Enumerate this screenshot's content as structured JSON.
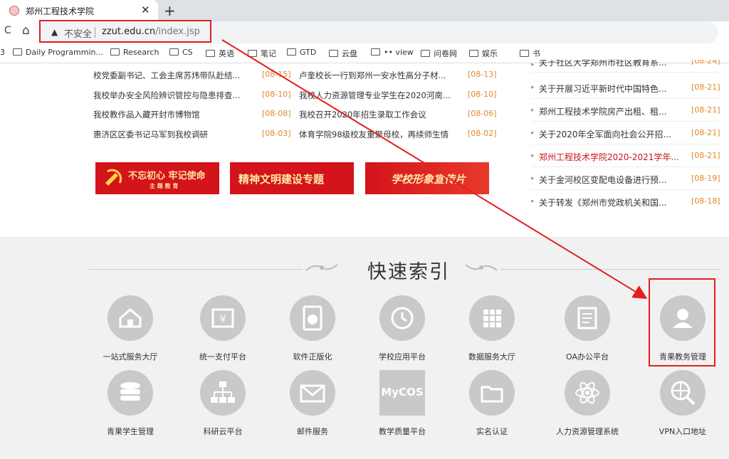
{
  "browser": {
    "tab_title": "郑州工程技术学院",
    "tab_close": "✕",
    "new_tab": "+",
    "back": "C",
    "home": "⌂",
    "warning_glyph": "▲",
    "security_label": "不安全",
    "url_host": "zzut.edu.cn",
    "url_path": "/index.jsp"
  },
  "bookmarks": [
    "Daily Programmin...",
    "Research",
    "CS",
    "英语",
    "笔记",
    "GTD",
    "云盘",
    "•• view",
    "问卷网",
    "娱乐",
    "书"
  ],
  "news_left": [
    {
      "title": "校党委副书记、工会主席苏炜带队赴结...",
      "date": "[08-15]"
    },
    {
      "title": "我校举办安全风险辨识管控与隐患排查...",
      "date": "[08-10]"
    },
    {
      "title": "我校教作品入藏开封市博物馆",
      "date": "[08-08]"
    },
    {
      "title": "惠济区区委书记马军到我校调研",
      "date": "[08-03]"
    }
  ],
  "news_mid": [
    {
      "title": "卢奎校长一行到郑州一安水性高分子材...",
      "date": "[08-13]"
    },
    {
      "title": "我校人力资源管理专业学生在2020河南...",
      "date": "[08-10]"
    },
    {
      "title": "我校召开2020年招生录取工作会议",
      "date": "[08-06]"
    },
    {
      "title": "体育学院98级校友重聚母校，再续师生情",
      "date": "[08-02]"
    }
  ],
  "banners": {
    "b1_main": "不忘初心 牢记使命",
    "b1_sub": "主 题 教 育",
    "b2": "精神文明建设专题",
    "b3": "学校形象宣传片"
  },
  "notices": [
    {
      "title": "关于社区大学郑州市社区教育系...",
      "date": "[08-24]"
    },
    {
      "title": "关于开展习近平新时代中国特色...",
      "date": "[08-21]"
    },
    {
      "title": "郑州工程技术学院房产出租、租...",
      "date": "[08-21]"
    },
    {
      "title": "关于2020年全军面向社会公开招...",
      "date": "[08-21]"
    },
    {
      "title": "郑州工程技术学院2020-2021学年...",
      "date": "[08-21]"
    },
    {
      "title": "关于金河校区变配电设备进行预...",
      "date": "[08-19]"
    },
    {
      "title": "关于转发《郑州市党政机关和国...",
      "date": "[08-18]"
    }
  ],
  "quick_index": {
    "title": "快速索引",
    "row1": [
      "一站式服务大厅",
      "统一支付平台",
      "软件正版化",
      "学校应用平台",
      "数据服务大厅",
      "OA办公平台",
      "青果教务管理"
    ],
    "row2": [
      "青果学生管理",
      "科研云平台",
      "邮件服务",
      "教学质量平台",
      "实名认证",
      "人力资源管理系统",
      "VPN入口地址"
    ],
    "mycos_text": "MyCOS",
    "yen_glyph": "¥"
  },
  "colors": {
    "accent_red": "#e02020",
    "date_orange": "#e0892a",
    "banner_red": "#d3141b"
  }
}
